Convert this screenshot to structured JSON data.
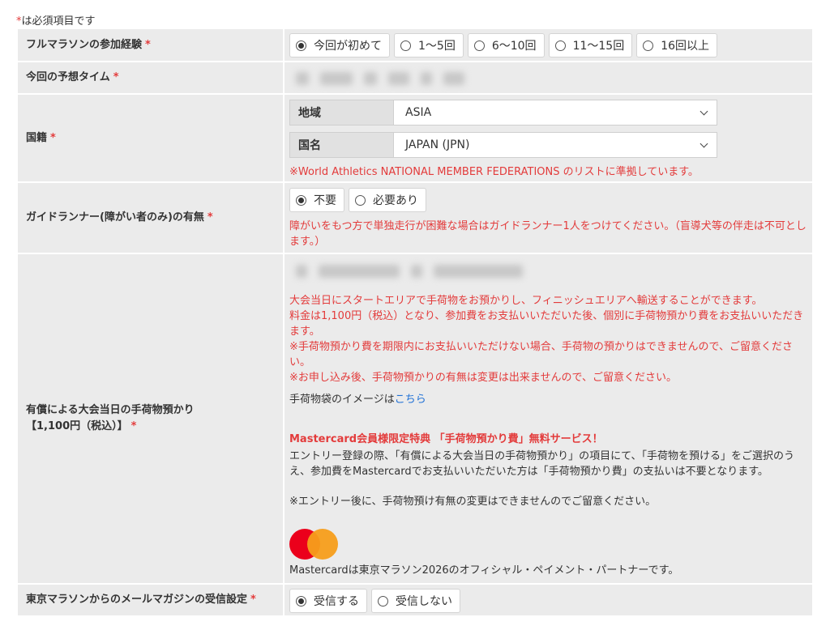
{
  "required_note": {
    "asterisk": "*",
    "text": "は必須項目です"
  },
  "asterisk": "*",
  "rows": {
    "marathon_exp": {
      "label": "フルマラソンの参加経験",
      "options": [
        "今回が初めて",
        "1〜5回",
        "6〜10回",
        "11〜15回",
        "16回以上"
      ],
      "selected": 0
    },
    "expected_time": {
      "label": "今回の予想タイム"
    },
    "nationality": {
      "label": "国籍",
      "region_label": "地域",
      "region_value": "ASIA",
      "country_label": "国名",
      "country_value": "JAPAN (JPN)",
      "note": "※World Athletics NATIONAL MEMBER FEDERATIONS のリストに準拠しています。"
    },
    "guide_runner": {
      "label": "ガイドランナー(障がい者のみ)の有無",
      "options": [
        "不要",
        "必要あり"
      ],
      "selected": 0,
      "note": "障がいをもつ方で単独走行が困難な場合はガイドランナー1人をつけてください。（盲導犬等の伴走は不可とします。）"
    },
    "baggage": {
      "label_line1": "有償による大会当日の手荷物預かり",
      "label_line2": "【1,100円（税込）】",
      "red_line1": "大会当日にスタートエリアで手荷物をお預かりし、フィニッシュエリアへ輸送することができます。",
      "red_line2": "料金は1,100円（税込）となり、参加費をお支払いいただいた後、個別に手荷物預かり費をお支払いいただきます。",
      "red_line3": "※手荷物預かり費を期限内にお支払いいただけない場合、手荷物の預かりはできませんので、ご留意ください。",
      "red_line4": "※お申し込み後、手荷物預かりの有無は変更は出来ませんので、ご留意ください。",
      "image_text": "手荷物袋のイメージは",
      "image_link": "こちら",
      "mc_title": "Mastercard会員様限定特典 「手荷物預かり費」無料サービス！",
      "mc_body": "エントリー登録の際、「有償による大会当日の手荷物預かり」の項目にて、「手荷物を預ける」をご選択のうえ、参加費をMastercardでお支払いいただいた方は「手荷物預かり費」の支払いは不要となります。",
      "after_note": "※エントリー後に、手荷物預け有無の変更はできませんのでご留意ください。",
      "partner": "Mastercardは東京マラソン2026のオフィシャル・ペイメント・パートナーです。"
    },
    "newsletter": {
      "label": "東京マラソンからのメールマガジンの受信設定",
      "options": [
        "受信する",
        "受信しない"
      ],
      "selected": 0
    }
  },
  "colors": {
    "required": "#e33b3b",
    "link": "#1d6fd6",
    "cell_bg": "#ebebeb"
  }
}
